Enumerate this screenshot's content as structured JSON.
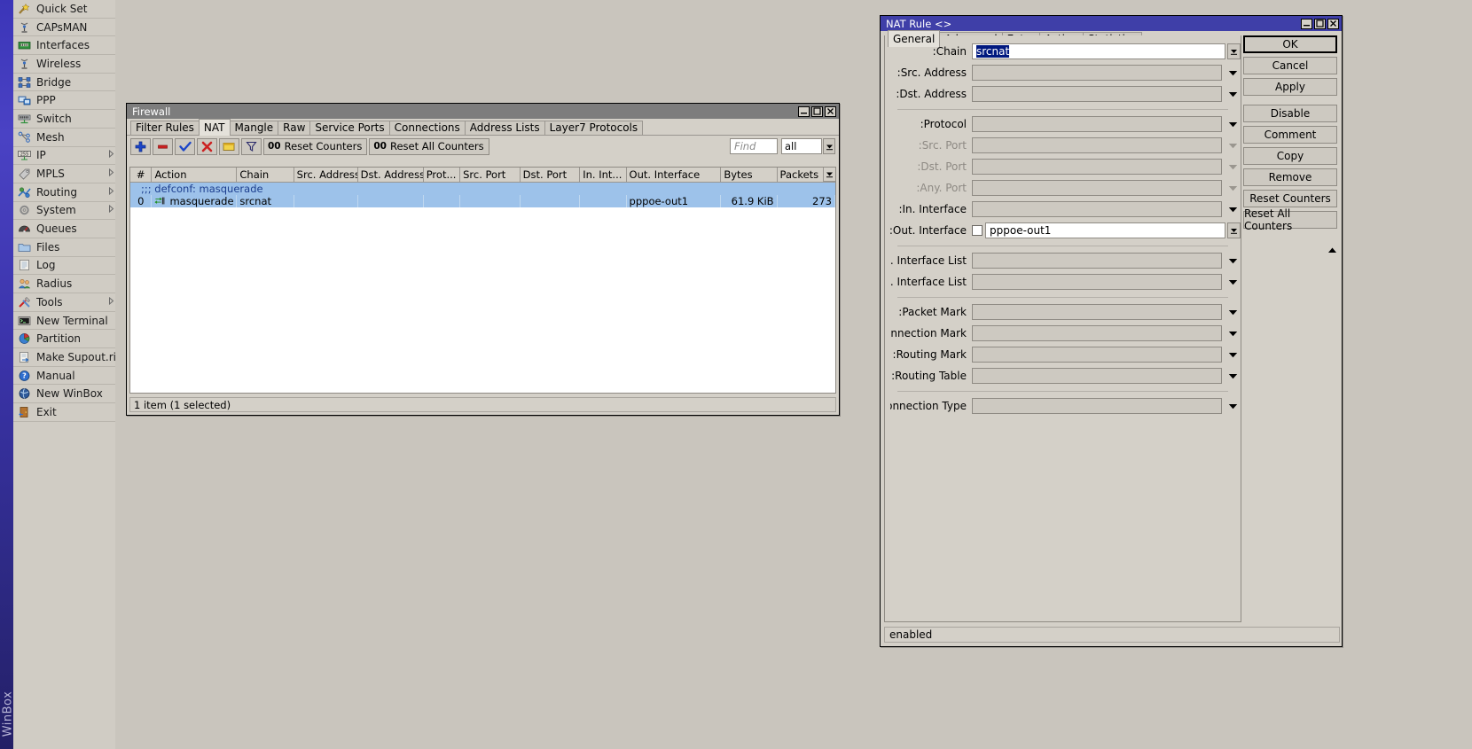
{
  "sidebar": {
    "brand": "WinBox",
    "items": [
      {
        "label": "Quick Set",
        "icon": "wand-icon",
        "arrow": false
      },
      {
        "label": "CAPsMAN",
        "icon": "antenna-icon",
        "arrow": false
      },
      {
        "label": "Interfaces",
        "icon": "nic-card-icon",
        "arrow": false
      },
      {
        "label": "Wireless",
        "icon": "antenna-icon",
        "arrow": false
      },
      {
        "label": "Bridge",
        "icon": "bridge-icon",
        "arrow": false
      },
      {
        "label": "PPP",
        "icon": "ppp-icon",
        "arrow": false
      },
      {
        "label": "Switch",
        "icon": "switch-icon",
        "arrow": false
      },
      {
        "label": "Mesh",
        "icon": "mesh-icon",
        "arrow": false
      },
      {
        "label": "IP",
        "icon": "ip-255-icon",
        "arrow": true
      },
      {
        "label": "MPLS",
        "icon": "mpls-tag-icon",
        "arrow": true
      },
      {
        "label": "Routing",
        "icon": "routing-icon",
        "arrow": true
      },
      {
        "label": "System",
        "icon": "gear-icon",
        "arrow": true
      },
      {
        "label": "Queues",
        "icon": "gauge-icon",
        "arrow": false
      },
      {
        "label": "Files",
        "icon": "folder-icon",
        "arrow": false
      },
      {
        "label": "Log",
        "icon": "log-page-icon",
        "arrow": false
      },
      {
        "label": "Radius",
        "icon": "users-icon",
        "arrow": false
      },
      {
        "label": "Tools",
        "icon": "tools-icon",
        "arrow": true
      },
      {
        "label": "New Terminal",
        "icon": "terminal-icon",
        "arrow": false
      },
      {
        "label": "Partition",
        "icon": "pie-icon",
        "arrow": false
      },
      {
        "label": "Make Supout.rif",
        "icon": "export-page-icon",
        "arrow": false
      },
      {
        "label": "Manual",
        "icon": "question-icon",
        "arrow": false
      },
      {
        "label": "New WinBox",
        "icon": "globe-icon",
        "arrow": false
      },
      {
        "label": "Exit",
        "icon": "door-exit-icon",
        "arrow": false
      }
    ]
  },
  "firewall": {
    "title": "Firewall",
    "window_buttons": [
      "minimize",
      "maximize",
      "close"
    ],
    "tabs": [
      {
        "label": "Filter Rules",
        "active": false
      },
      {
        "label": "NAT",
        "active": true
      },
      {
        "label": "Mangle",
        "active": false
      },
      {
        "label": "Raw",
        "active": false
      },
      {
        "label": "Service Ports",
        "active": false
      },
      {
        "label": "Connections",
        "active": false
      },
      {
        "label": "Address Lists",
        "active": false
      },
      {
        "label": "Layer7 Protocols",
        "active": false
      }
    ],
    "toolbar": {
      "add_label": "+",
      "remove_label": "−",
      "enable_label": "check-icon",
      "disable_label": "x-icon",
      "comment_label": "comment-icon",
      "filter_label": "filter-icon",
      "reset_counters_label": "Reset Counters",
      "reset_all_counters_label": "Reset All Counters",
      "counter_prefix": "00"
    },
    "search": {
      "find_placeholder": "Find",
      "filter_value": "all"
    },
    "table": {
      "columns": [
        "#",
        "Action",
        "Chain",
        "Src. Address",
        "Dst. Address",
        "Prot...",
        "Src. Port",
        "Dst. Port",
        "In. Int...",
        "Out. Interface",
        "Bytes",
        "Packets"
      ],
      "rows": [
        {
          "type": "comment",
          "selected": true,
          "text": ";;; defconf: masquerade"
        },
        {
          "type": "data",
          "selected": true,
          "num": "0",
          "action": "masquerade",
          "action_icon": "nat-arrows-icon",
          "chain": "srcnat",
          "src_address": "",
          "dst_address": "",
          "protocol": "",
          "src_port": "",
          "dst_port": "",
          "in_interface": "",
          "out_interface": "pppoe-out1",
          "bytes": "61.9 KiB",
          "packets": "273"
        }
      ]
    },
    "status": "1 item (1 selected)"
  },
  "nat_rule": {
    "title": "NAT Rule <>",
    "window_buttons": [
      "minimize",
      "maximize",
      "close"
    ],
    "tabs": [
      {
        "label": "General",
        "active": true
      },
      {
        "label": "Advanced",
        "active": false
      },
      {
        "label": "Extra",
        "active": false
      },
      {
        "label": "Action",
        "active": false
      },
      {
        "label": "Statistics",
        "active": false
      }
    ],
    "fields": [
      {
        "label": "Chain:",
        "value": "srcnat",
        "value_selected": true,
        "style": "white",
        "caret": "boxed",
        "disabled": false,
        "checkbox": false
      },
      {
        "label": "Src. Address:",
        "value": "",
        "style": "grey",
        "caret": "plain",
        "disabled": false,
        "checkbox": false
      },
      {
        "label": "Dst. Address:",
        "value": "",
        "style": "grey",
        "caret": "plain",
        "disabled": false,
        "checkbox": false
      },
      {
        "divider": true
      },
      {
        "label": "Protocol:",
        "value": "",
        "style": "grey",
        "caret": "plain",
        "disabled": false,
        "checkbox": false
      },
      {
        "label": "Src. Port:",
        "value": "",
        "style": "grey",
        "caret": "plain",
        "disabled": true,
        "checkbox": false
      },
      {
        "label": "Dst. Port:",
        "value": "",
        "style": "grey",
        "caret": "plain",
        "disabled": true,
        "checkbox": false
      },
      {
        "label": "Any. Port:",
        "value": "",
        "style": "grey",
        "caret": "plain",
        "disabled": true,
        "checkbox": false
      },
      {
        "label": "In. Interface:",
        "value": "",
        "style": "grey",
        "caret": "plain",
        "disabled": false,
        "checkbox": false
      },
      {
        "label": "Out. Interface:",
        "value": "pppoe-out1",
        "style": "white",
        "caret": "boxed",
        "disabled": false,
        "checkbox": true
      },
      {
        "divider": true
      },
      {
        "label": "In. Interface List:",
        "value": "",
        "style": "grey",
        "caret": "plain",
        "disabled": false,
        "checkbox": false
      },
      {
        "label": "Out. Interface List:",
        "value": "",
        "style": "grey",
        "caret": "plain",
        "disabled": false,
        "checkbox": false
      },
      {
        "divider": true
      },
      {
        "label": "Packet Mark:",
        "value": "",
        "style": "grey",
        "caret": "plain",
        "disabled": false,
        "checkbox": false
      },
      {
        "label": "Connection Mark:",
        "value": "",
        "style": "grey",
        "caret": "plain",
        "disabled": false,
        "checkbox": false
      },
      {
        "label": "Routing Mark:",
        "value": "",
        "style": "grey",
        "caret": "plain",
        "disabled": false,
        "checkbox": false
      },
      {
        "label": "Routing Table:",
        "value": "",
        "style": "grey",
        "caret": "plain",
        "disabled": false,
        "checkbox": false
      },
      {
        "divider": true
      },
      {
        "label": "Connection Type:",
        "value": "",
        "style": "grey",
        "caret": "plain",
        "disabled": false,
        "checkbox": false
      }
    ],
    "buttons": [
      {
        "label": "OK",
        "primary": true,
        "gap": false
      },
      {
        "label": "Cancel",
        "primary": false,
        "gap": false
      },
      {
        "label": "Apply",
        "primary": false,
        "gap": false
      },
      {
        "label": "Disable",
        "primary": false,
        "gap": true
      },
      {
        "label": "Comment",
        "primary": false,
        "gap": false
      },
      {
        "label": "Copy",
        "primary": false,
        "gap": false
      },
      {
        "label": "Remove",
        "primary": false,
        "gap": false
      },
      {
        "label": "Reset Counters",
        "primary": false,
        "gap": false
      },
      {
        "label": "Reset All Counters",
        "primary": false,
        "gap": false
      }
    ],
    "status": "enabled"
  },
  "colors": {
    "window_bg": "#d4d0c8",
    "desktop_bg": "#c9c5bd",
    "title_active": "#3f3fa8",
    "title_inactive": "#7d7d7d",
    "selection": "#9dc2ea",
    "text_selection": "#00187f"
  }
}
